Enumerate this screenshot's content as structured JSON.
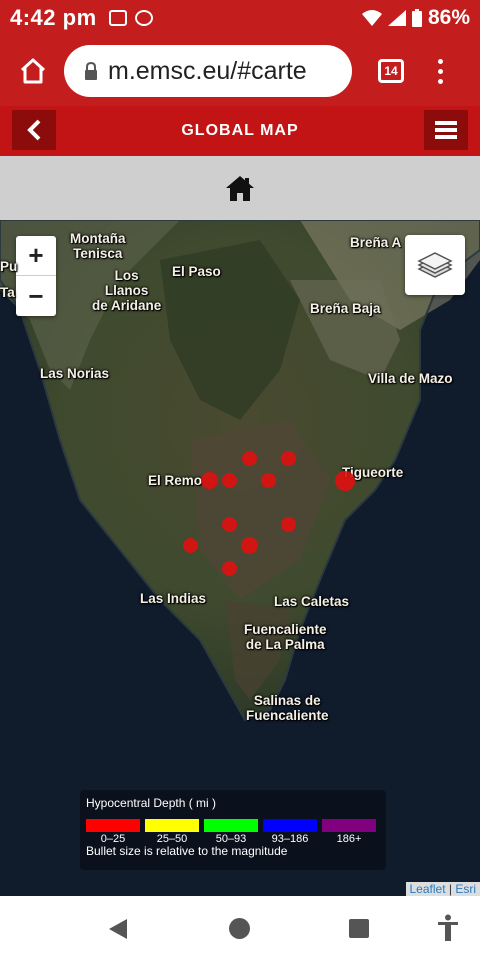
{
  "status_bar": {
    "time": "4:42 pm",
    "battery": "86%",
    "left_icons": [
      "image-icon",
      "messenger-icon"
    ],
    "right_icons": [
      "wifi-icon",
      "signal-icon",
      "battery-icon"
    ]
  },
  "browser": {
    "url": "m.emsc.eu/#carte",
    "tab_count": "14",
    "home_icon": "home-outline-icon",
    "menu_icon": "more-vert-icon"
  },
  "app_header": {
    "title": "GLOBAL MAP",
    "back_icon": "chevron-left-icon",
    "menu_icon": "hamburger-icon"
  },
  "home_bar": {
    "icon": "home-icon"
  },
  "map": {
    "zoom_in": "+",
    "zoom_out": "−",
    "labels": {
      "puntagorda": "Pu",
      "tijarafe": "Ta",
      "montana": "Montaña\nTenisca",
      "los_llanos": "Los\nLlanos\nde Aridane",
      "el_paso": "El Paso",
      "brena_alta": "Breña A",
      "brena_baja": "Breña Baja",
      "las_norias": "Las Norias",
      "villa_de_mazo": "Villa de Mazo",
      "el_remo": "El Remo",
      "tigueorte": "Tigueorte",
      "las_indias": "Las Indias",
      "las_caletas": "Las Caletas",
      "fuencaliente": "Fuencaliente\nde La Palma",
      "salinas": "Salinas de\nFuencaliente"
    },
    "legend": {
      "title": "Hypocentral Depth ( mi )",
      "items": [
        {
          "range": "0–25",
          "color": "#ff0000"
        },
        {
          "range": "25–50",
          "color": "#ffff00"
        },
        {
          "range": "50–93",
          "color": "#00ff00"
        },
        {
          "range": "93–186",
          "color": "#0000ff"
        },
        {
          "range": "186+",
          "color": "#800080"
        }
      ],
      "note": "Bullet size is relative to the magnitude"
    },
    "attribution": {
      "leaflet": "Leaflet",
      "separator": " | ",
      "esri": "Esri"
    }
  }
}
